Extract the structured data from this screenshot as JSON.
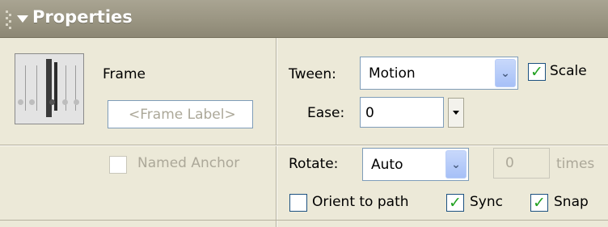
{
  "panel": {
    "title": "Properties"
  },
  "frame": {
    "label": "Frame",
    "label_placeholder": "<Frame Label>",
    "named_anchor_label": "Named Anchor",
    "named_anchor_checked": false
  },
  "tween": {
    "label": "Tween:",
    "value": "Motion",
    "scale_label": "Scale",
    "scale_checked": true
  },
  "ease": {
    "label": "Ease:",
    "value": "0"
  },
  "rotate": {
    "label": "Rotate:",
    "value": "Auto",
    "times_value": "0",
    "times_label": "times"
  },
  "options": {
    "orient_label": "Orient to path",
    "orient_checked": false,
    "sync_label": "Sync",
    "sync_checked": true,
    "snap_label": "Snap",
    "snap_checked": true
  },
  "icons": {
    "collapse": "triangle-down-icon",
    "grip": "grip-handle-icon",
    "frame": "frame-timeline-icon",
    "dropdown": "chevron-down-icon",
    "checkmark": "checkmark-icon"
  },
  "colors": {
    "titlebar": "#9a9582",
    "panel_bg": "#ece9d8",
    "check_green": "#21a121",
    "input_border": "#7f9db9"
  }
}
